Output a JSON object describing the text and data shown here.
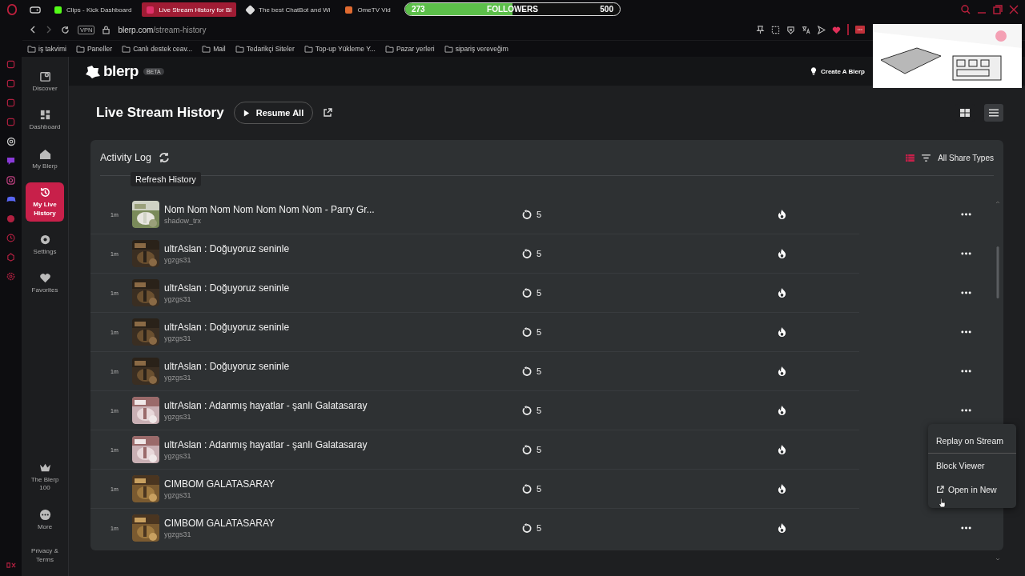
{
  "browser": {
    "tabs": [
      {
        "label": "Clips - Kick Dashboard",
        "selected": false
      },
      {
        "label": "Live Stream History for Bl",
        "selected": true
      },
      {
        "label": "The best ChatBot and Wi",
        "selected": false
      },
      {
        "label": "OmeTV Vid",
        "selected": false
      }
    ],
    "vpn": "VPN",
    "address_host": "blerp.com",
    "address_path": "/stream-history",
    "bookmarks": [
      "iş takvimi",
      "Paneller",
      "Canlı destek ceav...",
      "Mail",
      "Tedarikçi Siteler",
      "Top-up Yükleme Y...",
      "Pazar yerleri",
      "sipariş vereveğim"
    ]
  },
  "followers_overlay": {
    "current": "273",
    "label": "FOLLOWERS",
    "goal": "500",
    "level": 0.5
  },
  "app": {
    "logo": "blerp",
    "badge": "BETA",
    "create": "Create A Blerp"
  },
  "nav": [
    {
      "label": "Discover",
      "selected": false
    },
    {
      "label": "Dashboard",
      "selected": false
    },
    {
      "label": "My Blerp",
      "selected": false
    },
    {
      "label": "My Live History",
      "selected": true
    },
    {
      "label": "Settings",
      "selected": false
    },
    {
      "label": "Favorites",
      "selected": false
    }
  ],
  "nav_bottom": [
    {
      "label": "The Blerp 100",
      "selected": false
    },
    {
      "label": "More",
      "selected": false
    },
    {
      "label": "Privacy & Terms",
      "selected": false
    }
  ],
  "page": {
    "title": "Live Stream History",
    "resume": "Resume All",
    "views": [
      {
        "kind": "grid",
        "selected": false
      },
      {
        "kind": "list",
        "selected": true
      }
    ]
  },
  "log": {
    "title": "Activity Log",
    "tooltip": "Refresh History",
    "filter": "All Share Types",
    "rows": [
      {
        "time": "1m",
        "title": "Nom Nom Nom Nom Nom Nom Nom - Parry Gr...",
        "user": "shadow_trx",
        "count": "5"
      },
      {
        "time": "1m",
        "title": "ultrAslan : Doğuyoruz seninle",
        "user": "ygzgs31",
        "count": "5"
      },
      {
        "time": "1m",
        "title": "ultrAslan : Doğuyoruz seninle",
        "user": "ygzgs31",
        "count": "5"
      },
      {
        "time": "1m",
        "title": "ultrAslan : Doğuyoruz seninle",
        "user": "ygzgs31",
        "count": "5"
      },
      {
        "time": "1m",
        "title": "ultrAslan : Doğuyoruz seninle",
        "user": "ygzgs31",
        "count": "5"
      },
      {
        "time": "1m",
        "title": "ultrAslan : Adanmış hayatlar - şanlı Galatasaray",
        "user": "ygzgs31",
        "count": "5"
      },
      {
        "time": "1m",
        "title": "ultrAslan : Adanmış hayatlar - şanlı Galatasaray",
        "user": "ygzgs31",
        "count": "5"
      },
      {
        "time": "1m",
        "title": "CIMBOM GALATASARAY",
        "user": "ygzgs31",
        "count": "5"
      },
      {
        "time": "1m",
        "title": "CIMBOM GALATASARAY",
        "user": "ygzgs31",
        "count": "5"
      }
    ],
    "menu": [
      "Replay on Stream",
      "Block Viewer",
      "Open in New"
    ]
  }
}
